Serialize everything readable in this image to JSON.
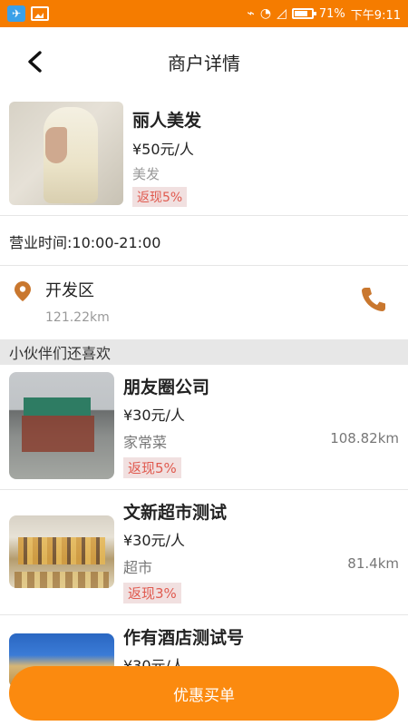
{
  "status_bar": {
    "battery": "71%",
    "time": "下午9:11"
  },
  "nav": {
    "title": "商户详情"
  },
  "merchant": {
    "name": "丽人美发",
    "price": "¥50元/人",
    "category": "美发",
    "cashback": "返现5%",
    "hours": "营业时间:10:00-21:00",
    "address": "开发区",
    "distance": "121.22km"
  },
  "recommend": {
    "title": "小伙伴们还喜欢",
    "items": [
      {
        "name": "朋友圈公司",
        "price": "¥30元/人",
        "category": "家常菜",
        "distance": "108.82km",
        "cashback": "返现5%"
      },
      {
        "name": "文新超市测试",
        "price": "¥30元/人",
        "category": "超市",
        "distance": "81.4km",
        "cashback": "返现3%"
      },
      {
        "name": "作有酒店测试号",
        "price": "¥30元/人",
        "category": "",
        "distance": "",
        "cashback": ""
      }
    ]
  },
  "bottom_button": "优惠买单",
  "colors": {
    "accent": "#f57c00",
    "button": "#fb8a0f",
    "cashback_text": "#e05a4f",
    "cashback_bg": "#f1e0e0",
    "pin": "#c9772e"
  }
}
